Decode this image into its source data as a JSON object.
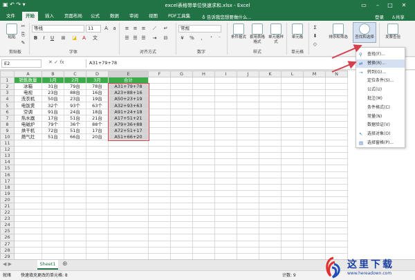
{
  "window": {
    "title": "excel表格带单位快速求和.xlsx - Excel",
    "login": "登录",
    "share": "共享"
  },
  "tabs": [
    "文件",
    "开始",
    "插入",
    "页面布局",
    "公式",
    "数据",
    "审阅",
    "视图",
    "PDF工具集"
  ],
  "tell_me": "告诉我您想要做什么...",
  "ribbon": {
    "font_name": "等线",
    "font_size": "11",
    "number_format": "常规",
    "groups": [
      "剪贴板",
      "字体",
      "对齐方式",
      "数字",
      "样式",
      "单元格",
      "编辑"
    ],
    "buttons": {
      "paste": "粘贴",
      "cond_format": "条件格式",
      "table_format": "套用表格格式",
      "cell_style": "单元格样式",
      "cells": "单元格",
      "sort_filter": "排序和筛选",
      "find_select": "查找和选择",
      "invoice": "发票查验"
    }
  },
  "namebox": "E2",
  "formula": "A31+79+78",
  "columns": [
    "A",
    "B",
    "C",
    "D",
    "E",
    "F",
    "G",
    "H",
    "I",
    "J",
    "K",
    "L",
    "M",
    "N"
  ],
  "headers": [
    "销售数量",
    "1月",
    "2月",
    "3月",
    "合计"
  ],
  "rows": [
    [
      "冰箱",
      "31台",
      "79台",
      "78台",
      "A31+79+78"
    ],
    [
      "电视",
      "23台",
      "88台",
      "16台",
      "A23+88+16"
    ],
    [
      "洗衣机",
      "50台",
      "23台",
      "19台",
      "A50+23+19"
    ],
    [
      "电饭煲",
      "32个",
      "93个",
      "63个",
      "A32+93+63"
    ],
    [
      "空调",
      "91台",
      "24台",
      "18台",
      "A91+24+18"
    ],
    [
      "热水器",
      "17台",
      "51台",
      "21台",
      "A17+51+21"
    ],
    [
      "电磁炉",
      "79个",
      "36个",
      "88个",
      "A79+36+88"
    ],
    [
      "烘干机",
      "72台",
      "51台",
      "17台",
      "A72+51+17"
    ],
    [
      "燃气灶",
      "51台",
      "66台",
      "20台",
      "A51+66+20"
    ]
  ],
  "row_numbers": [
    "1",
    "2",
    "3",
    "4",
    "5",
    "6",
    "7",
    "8",
    "9",
    "10",
    "11",
    "12",
    "13",
    "14",
    "15",
    "16",
    "17",
    "18",
    "19",
    "20",
    "21",
    "22",
    "23",
    "24",
    "25",
    "26",
    "27",
    "28",
    "29"
  ],
  "sheet_tab": "Sheet1",
  "status": {
    "left": "快速填充更改的单元格: 8",
    "ready": "就绪",
    "count": "计数: 9"
  },
  "menu": [
    {
      "label": "查找(F)...",
      "icon": "search-icon"
    },
    {
      "label": "替换(R)...",
      "icon": "replace-icon",
      "highlight": true
    },
    {
      "label": "转到(G)...",
      "icon": "goto-arrow-icon"
    },
    {
      "label": "定位条件(S)...",
      "icon": ""
    },
    {
      "label": "公式(U)",
      "icon": ""
    },
    {
      "label": "批注(M)",
      "icon": ""
    },
    {
      "label": "条件格式(C)",
      "icon": ""
    },
    {
      "label": "常量(N)",
      "icon": ""
    },
    {
      "label": "数据验证(V)",
      "icon": ""
    },
    {
      "label": "选择对象(O)",
      "icon": "cursor-icon"
    },
    {
      "label": "选择窗格(P)...",
      "icon": "pane-icon"
    }
  ],
  "watermark": {
    "name": "这里下载",
    "url": "www.hereadown.com"
  },
  "colors": {
    "excel_green": "#217346",
    "header_fill": "#3cab4a",
    "selection_border": "#d3414f",
    "menu_highlight": "#d5e1f2"
  }
}
